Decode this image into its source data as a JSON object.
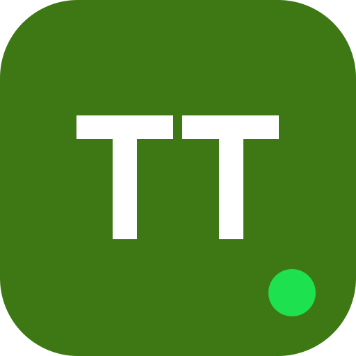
{
  "app_icon": {
    "monogram": "TT",
    "background_color": "#3e7814",
    "monogram_color": "#ffffff",
    "status_dot": {
      "state": "online",
      "color": "#1ee150"
    }
  }
}
